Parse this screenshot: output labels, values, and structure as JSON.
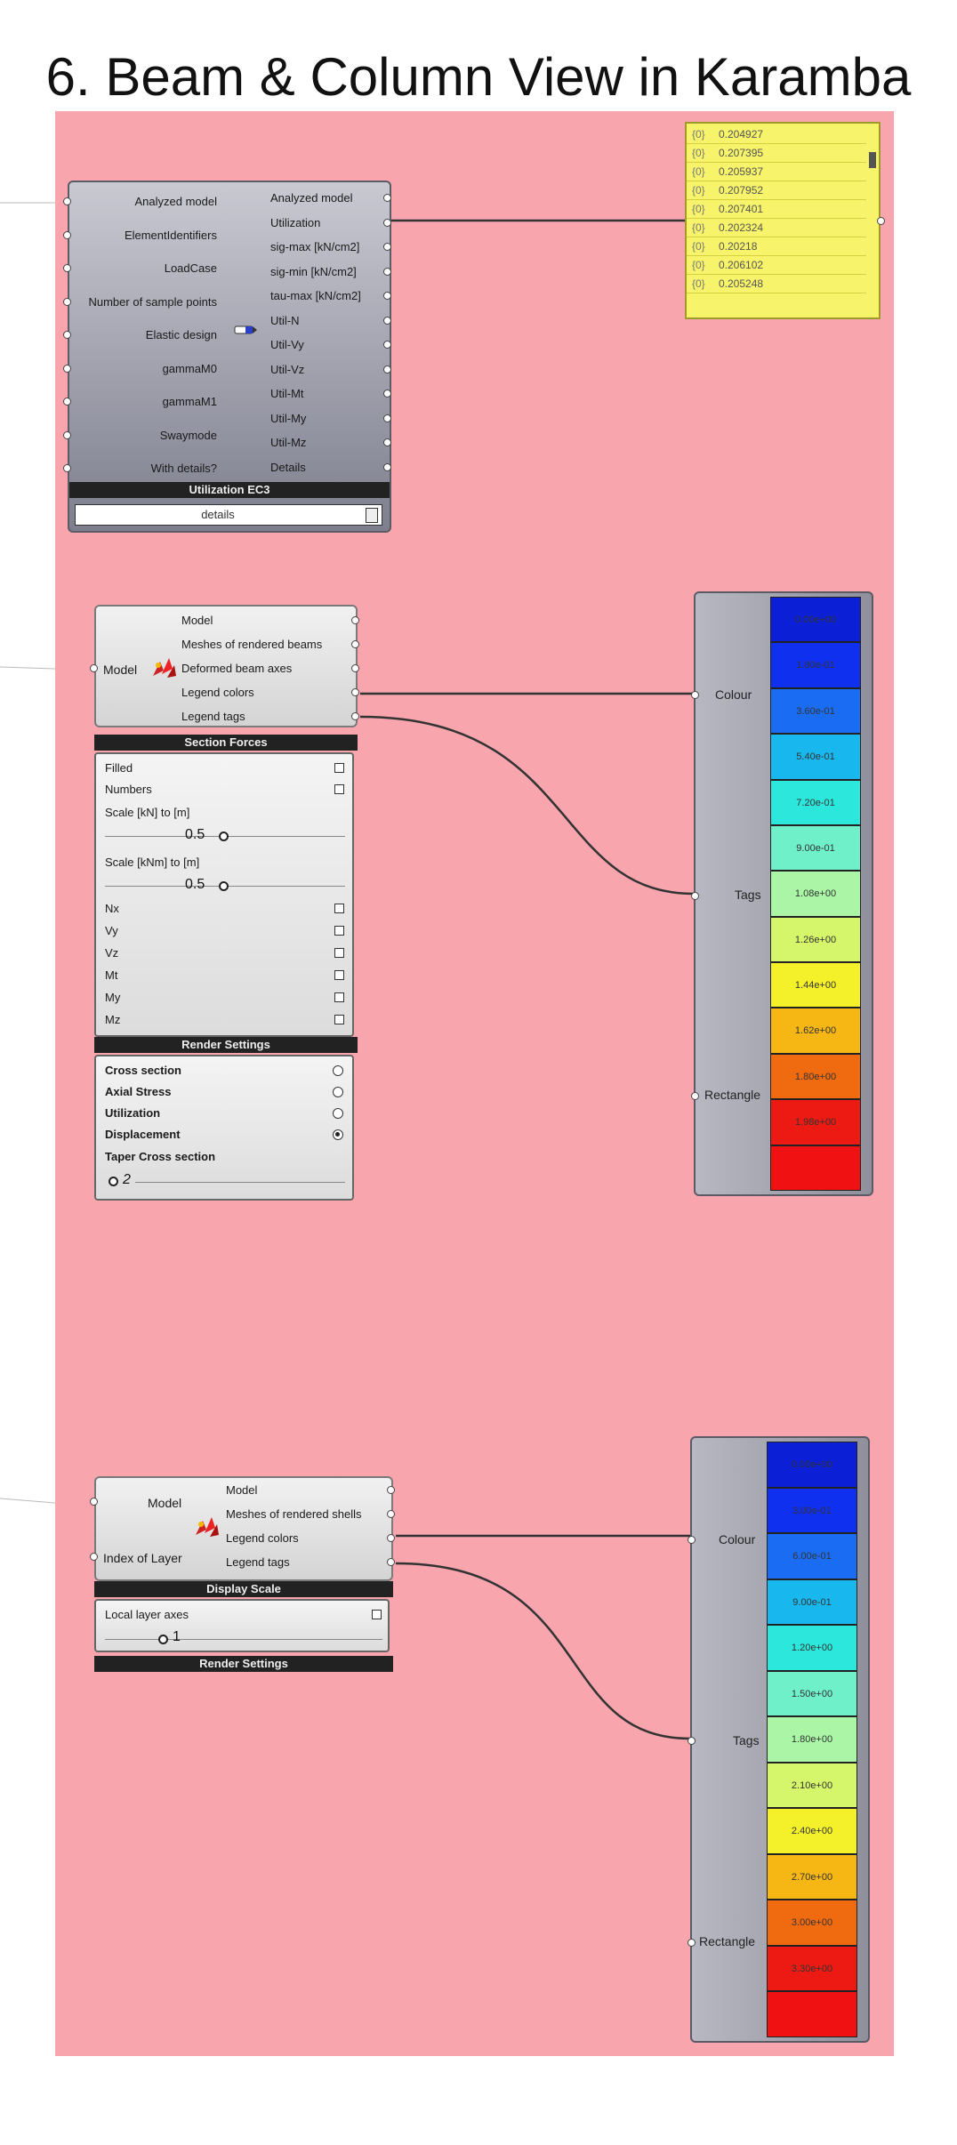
{
  "title": "6. Beam & Column View in Karamba",
  "utilization": {
    "inputs": [
      "Analyzed model",
      "ElementIdentifiers",
      "LoadCase",
      "Number of sample points",
      "Elastic design",
      "gammaM0",
      "gammaM1",
      "Swaymode",
      "With details?"
    ],
    "outputs": [
      "Analyzed model",
      "Utilization",
      "sig-max [kN/cm2]",
      "sig-min [kN/cm2]",
      "tau-max [kN/cm2]",
      "Util-N",
      "Util-Vy",
      "Util-Vz",
      "Util-Mt",
      "Util-My",
      "Util-Mz",
      "Details"
    ],
    "bar_label": "Utilization EC3",
    "dropdown_value": "details"
  },
  "panel_rows": [
    {
      "idx": "{0}",
      "val": "0.204927"
    },
    {
      "idx": "{0}",
      "val": "0.207395"
    },
    {
      "idx": "{0}",
      "val": "0.205937"
    },
    {
      "idx": "{0}",
      "val": "0.207952"
    },
    {
      "idx": "{0}",
      "val": "0.207401"
    },
    {
      "idx": "{0}",
      "val": "0.202324"
    },
    {
      "idx": "{0}",
      "val": "0.20218"
    },
    {
      "idx": "{0}",
      "val": "0.206102"
    },
    {
      "idx": "{0}",
      "val": "0.205248"
    }
  ],
  "beam_view": {
    "input": "Model",
    "outputs": [
      "Model",
      "Meshes of rendered beams",
      "Deformed beam axes",
      "Legend colors",
      "Legend tags"
    ],
    "bar1": "Section Forces",
    "checks_top": [
      {
        "label": "Filled",
        "checked": false
      },
      {
        "label": "Numbers",
        "checked": false
      }
    ],
    "scale1_label": "Scale [kN] to [m]",
    "scale1_value": "0.5",
    "scale2_label": "Scale [kNm] to [m]",
    "scale2_value": "0.5",
    "checks_bottom": [
      {
        "label": "Nx",
        "checked": false
      },
      {
        "label": "Vy",
        "checked": false
      },
      {
        "label": "Vz",
        "checked": false
      },
      {
        "label": "Mt",
        "checked": false
      },
      {
        "label": "My",
        "checked": false
      },
      {
        "label": "Mz",
        "checked": false
      }
    ],
    "bar2": "Render Settings",
    "radios": [
      {
        "label": "Cross section",
        "on": false
      },
      {
        "label": "Axial Stress",
        "on": false
      },
      {
        "label": "Utilization",
        "on": false
      },
      {
        "label": "Displacement",
        "on": true
      }
    ],
    "taper_label": "Taper Cross section",
    "taper_value": "2"
  },
  "legend1": {
    "ports": [
      "Colour",
      "Tags",
      "Rectangle"
    ],
    "cells": [
      {
        "color": "#0a1fd6",
        "text": "0.00e+00"
      },
      {
        "color": "#1030f0",
        "text": "1.80e-01"
      },
      {
        "color": "#1a6df2",
        "text": "3.60e-01"
      },
      {
        "color": "#18b8ee",
        "text": "5.40e-01"
      },
      {
        "color": "#2ce8dc",
        "text": "7.20e-01"
      },
      {
        "color": "#6ff0c8",
        "text": "9.00e-01"
      },
      {
        "color": "#aaf6a6",
        "text": "1.08e+00"
      },
      {
        "color": "#d5f56a",
        "text": "1.26e+00"
      },
      {
        "color": "#f4f12a",
        "text": "1.44e+00"
      },
      {
        "color": "#f6b714",
        "text": "1.62e+00"
      },
      {
        "color": "#f06a10",
        "text": "1.80e+00"
      },
      {
        "color": "#ec1a12",
        "text": "1.98e+00"
      },
      {
        "color": "#f01212",
        "text": ""
      }
    ]
  },
  "shell_view": {
    "inputs": [
      "Model",
      "Index of Layer"
    ],
    "outputs": [
      "Model",
      "Meshes of rendered shells",
      "Legend colors",
      "Legend tags"
    ],
    "bar1": "Display Scale",
    "check_label": "Local layer axes",
    "slider_value": "1",
    "bar2": "Render Settings"
  },
  "legend2": {
    "ports": [
      "Colour",
      "Tags",
      "Rectangle"
    ],
    "cells": [
      {
        "color": "#0a1fd6",
        "text": "0.00e+00"
      },
      {
        "color": "#1030f0",
        "text": "3.00e-01"
      },
      {
        "color": "#1a6df2",
        "text": "6.00e-01"
      },
      {
        "color": "#18b8ee",
        "text": "9.00e-01"
      },
      {
        "color": "#2ce8dc",
        "text": "1.20e+00"
      },
      {
        "color": "#6ff0c8",
        "text": "1.50e+00"
      },
      {
        "color": "#aaf6a6",
        "text": "1.80e+00"
      },
      {
        "color": "#d5f56a",
        "text": "2.10e+00"
      },
      {
        "color": "#f4f12a",
        "text": "2.40e+00"
      },
      {
        "color": "#f6b714",
        "text": "2.70e+00"
      },
      {
        "color": "#f06a10",
        "text": "3.00e+00"
      },
      {
        "color": "#ec1a12",
        "text": "3.30e+00"
      },
      {
        "color": "#f01212",
        "text": ""
      }
    ]
  }
}
